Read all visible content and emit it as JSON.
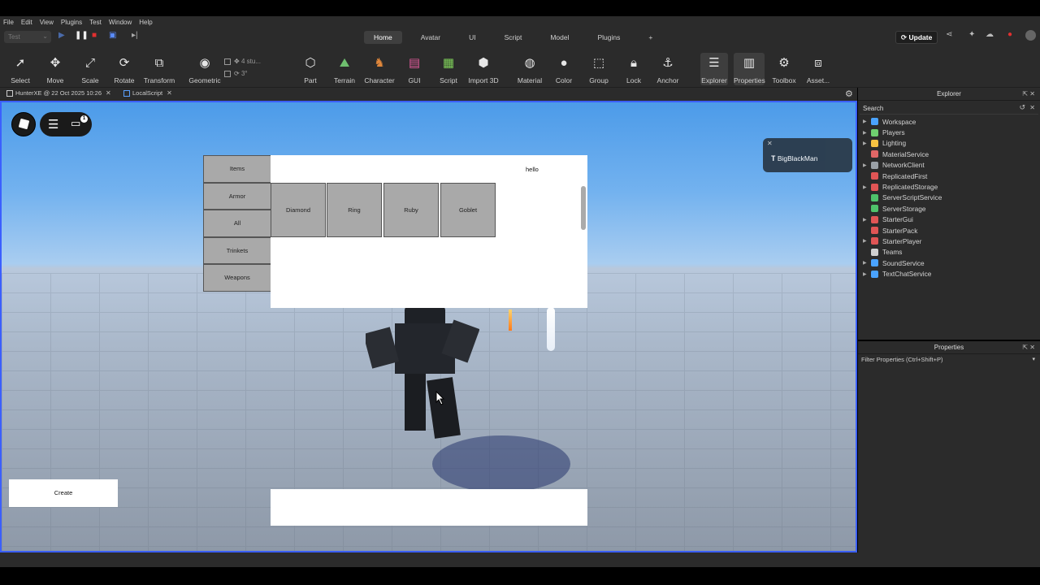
{
  "menu": [
    "File",
    "Edit",
    "View",
    "Plugins",
    "Test",
    "Window",
    "Help"
  ],
  "toolbar_top": {
    "mode_select": "Test",
    "tabs": [
      {
        "label": "Home",
        "active": true
      },
      {
        "label": "Avatar",
        "active": false
      },
      {
        "label": "UI",
        "active": false
      },
      {
        "label": "Script",
        "active": false
      },
      {
        "label": "Model",
        "active": false
      },
      {
        "label": "Plugins",
        "active": false
      },
      {
        "label": "+",
        "active": false
      }
    ],
    "update_label": "Update"
  },
  "ribbon": {
    "tools": [
      {
        "label": "Select",
        "icon": "cursor-arrow-icon"
      },
      {
        "label": "Move",
        "icon": "move-arrows-icon"
      },
      {
        "label": "Scale",
        "icon": "scale-icon"
      },
      {
        "label": "Rotate",
        "icon": "rotate-icon"
      },
      {
        "label": "Transform",
        "icon": "transform-icon"
      },
      {
        "label": "Geometric",
        "icon": "pivot-icon"
      },
      {
        "label": "Part",
        "icon": "cube-icon"
      },
      {
        "label": "Terrain",
        "icon": "mountain-icon"
      },
      {
        "label": "Character",
        "icon": "character-icon"
      },
      {
        "label": "GUI",
        "icon": "gui-icon"
      },
      {
        "label": "Script",
        "icon": "script-icon"
      },
      {
        "label": "Import 3D",
        "icon": "import-icon"
      },
      {
        "label": "Material",
        "icon": "material-icon"
      },
      {
        "label": "Color",
        "icon": "color-icon"
      },
      {
        "label": "Group",
        "icon": "group-icon"
      },
      {
        "label": "Lock",
        "icon": "lock-icon"
      },
      {
        "label": "Anchor",
        "icon": "anchor-icon"
      },
      {
        "label": "Explorer",
        "icon": "explorer-icon"
      },
      {
        "label": "Properties",
        "icon": "properties-icon"
      },
      {
        "label": "Toolbox",
        "icon": "toolbox-icon"
      },
      {
        "label": "Asset...",
        "icon": "asset-icon"
      }
    ],
    "snap_move": "4 stu...",
    "snap_rotate": "3°"
  },
  "doc_tabs": [
    {
      "label": "HunterXE @ 22 Oct 2025 10:26"
    },
    {
      "label": "LocalScript"
    }
  ],
  "game_gui": {
    "categories": [
      "Items",
      "Armor",
      "All",
      "Trinkets",
      "Weapons"
    ],
    "panel_title": "hello",
    "items": [
      "Diamond",
      "Ring",
      "Ruby",
      "Goblet"
    ],
    "create_label": "Create",
    "player_name": "BigBlackMan",
    "chat_badge": "1"
  },
  "explorer": {
    "title": "Explorer",
    "search_placeholder": "Search",
    "items": [
      {
        "label": "Workspace",
        "color": "#4aa3ff",
        "expandable": true
      },
      {
        "label": "Players",
        "color": "#6fcf6f",
        "expandable": true
      },
      {
        "label": "Lighting",
        "color": "#f5c242",
        "expandable": true
      },
      {
        "label": "MaterialService",
        "color": "#e06666",
        "expandable": false
      },
      {
        "label": "NetworkClient",
        "color": "#9aa0a6",
        "expandable": true
      },
      {
        "label": "ReplicatedFirst",
        "color": "#e05555",
        "expandable": false
      },
      {
        "label": "ReplicatedStorage",
        "color": "#e05555",
        "expandable": true
      },
      {
        "label": "ServerScriptService",
        "color": "#4fc26b",
        "expandable": false
      },
      {
        "label": "ServerStorage",
        "color": "#4fc26b",
        "expandable": false
      },
      {
        "label": "StarterGui",
        "color": "#e05555",
        "expandable": true
      },
      {
        "label": "StarterPack",
        "color": "#e05555",
        "expandable": false
      },
      {
        "label": "StarterPlayer",
        "color": "#e05555",
        "expandable": true
      },
      {
        "label": "Teams",
        "color": "#d0d0d0",
        "expandable": false
      },
      {
        "label": "SoundService",
        "color": "#4aa3ff",
        "expandable": true
      },
      {
        "label": "TextChatService",
        "color": "#4aa3ff",
        "expandable": true
      }
    ]
  },
  "properties": {
    "title": "Properties",
    "filter_placeholder": "Filter Properties (Ctrl+Shift+P)"
  }
}
